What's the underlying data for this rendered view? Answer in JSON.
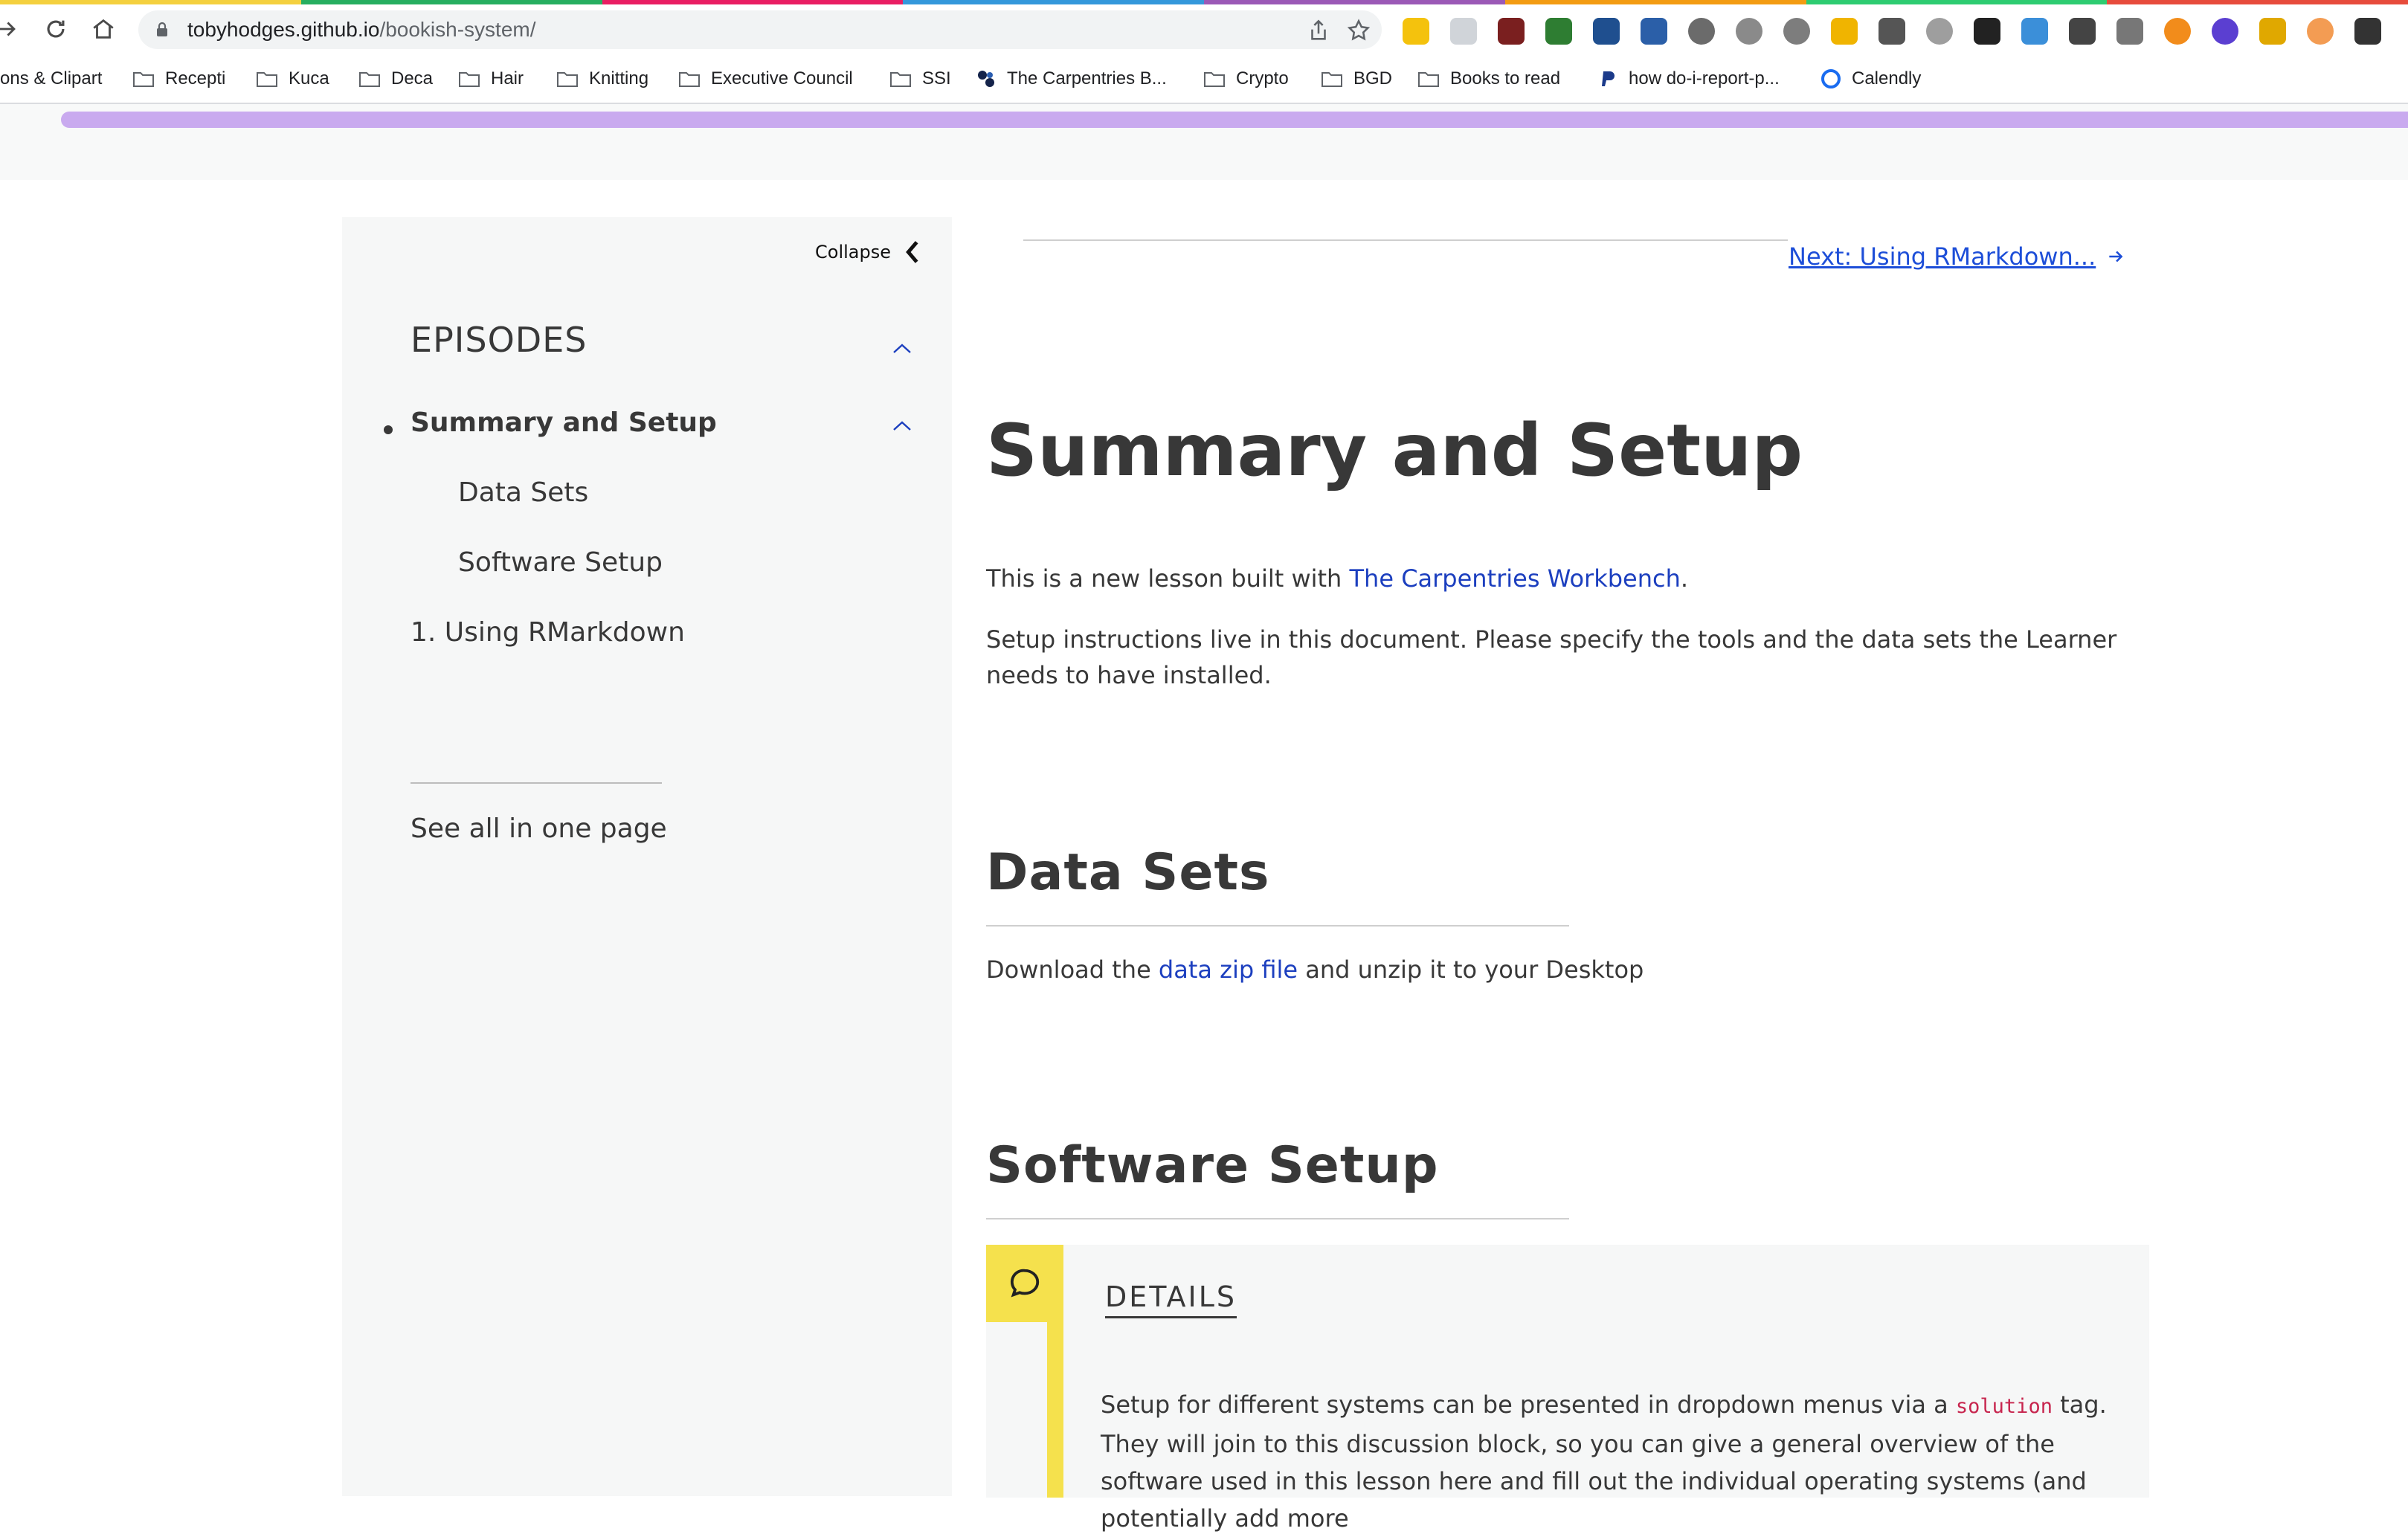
{
  "browser": {
    "url_host": "tobyhodges.github.io",
    "url_path": "/bookish-system/",
    "stripe_colors": [
      "#f4d03f",
      "#27ae60",
      "#e91e63",
      "#3498db",
      "#9b59b6",
      "#f39c12",
      "#2ecc71",
      "#e74c3c"
    ],
    "bookmarks": [
      {
        "label": "ons & Clipart",
        "icon": "none"
      },
      {
        "label": "Recepti",
        "icon": "folder-icon"
      },
      {
        "label": "Kuca",
        "icon": "folder-icon"
      },
      {
        "label": "Deca",
        "icon": "folder-icon"
      },
      {
        "label": "Hair",
        "icon": "folder-icon"
      },
      {
        "label": "Knitting",
        "icon": "folder-icon"
      },
      {
        "label": "Executive Council",
        "icon": "folder-icon"
      },
      {
        "label": "SSI",
        "icon": "folder-icon"
      },
      {
        "label": "The Carpentries B...",
        "icon": "carpentries-icon"
      },
      {
        "label": "Crypto",
        "icon": "folder-icon"
      },
      {
        "label": "BGD",
        "icon": "folder-icon"
      },
      {
        "label": "Books to read",
        "icon": "folder-icon"
      },
      {
        "label": "how do-i-report-p...",
        "icon": "paypal-icon"
      },
      {
        "label": "Calendly",
        "icon": "calendly-icon"
      }
    ]
  },
  "sidebar": {
    "collapse_label": "Collapse",
    "episodes_title": "EPISODES",
    "current_episode": "Summary and Setup",
    "subsections": [
      "Data Sets",
      "Software Setup"
    ],
    "episodes": [
      "1. Using RMarkdown"
    ],
    "all_in_one": "See all in one page"
  },
  "main": {
    "next_link": "Next: Using RMarkdown...",
    "title": "Summary and Setup",
    "intro_before": "This is a new lesson built with ",
    "intro_link": "The Carpentries Workbench",
    "intro_after": ".",
    "setup_text": "Setup instructions live in this document. Please specify the tools and the data sets the Learner needs to have installed.",
    "data_sets_heading": "Data Sets",
    "download_before": "Download the ",
    "download_link": "data zip file",
    "download_after": " and unzip it to your Desktop",
    "software_heading": "Software Setup",
    "callout": {
      "title": "DETAILS",
      "text_before": "Setup for different systems can be presented in dropdown menus via a ",
      "code": "solution",
      "text_after": " tag. They will join to this discussion block, so you can give a general overview of the software used in this lesson here and fill out the individual operating systems (and potentially add more"
    }
  },
  "colors": {
    "link": "#1c3fbf",
    "progress": "#c9aaef",
    "callout_accent": "#f5e14d",
    "sidebar_bg": "#f6f7f7"
  }
}
